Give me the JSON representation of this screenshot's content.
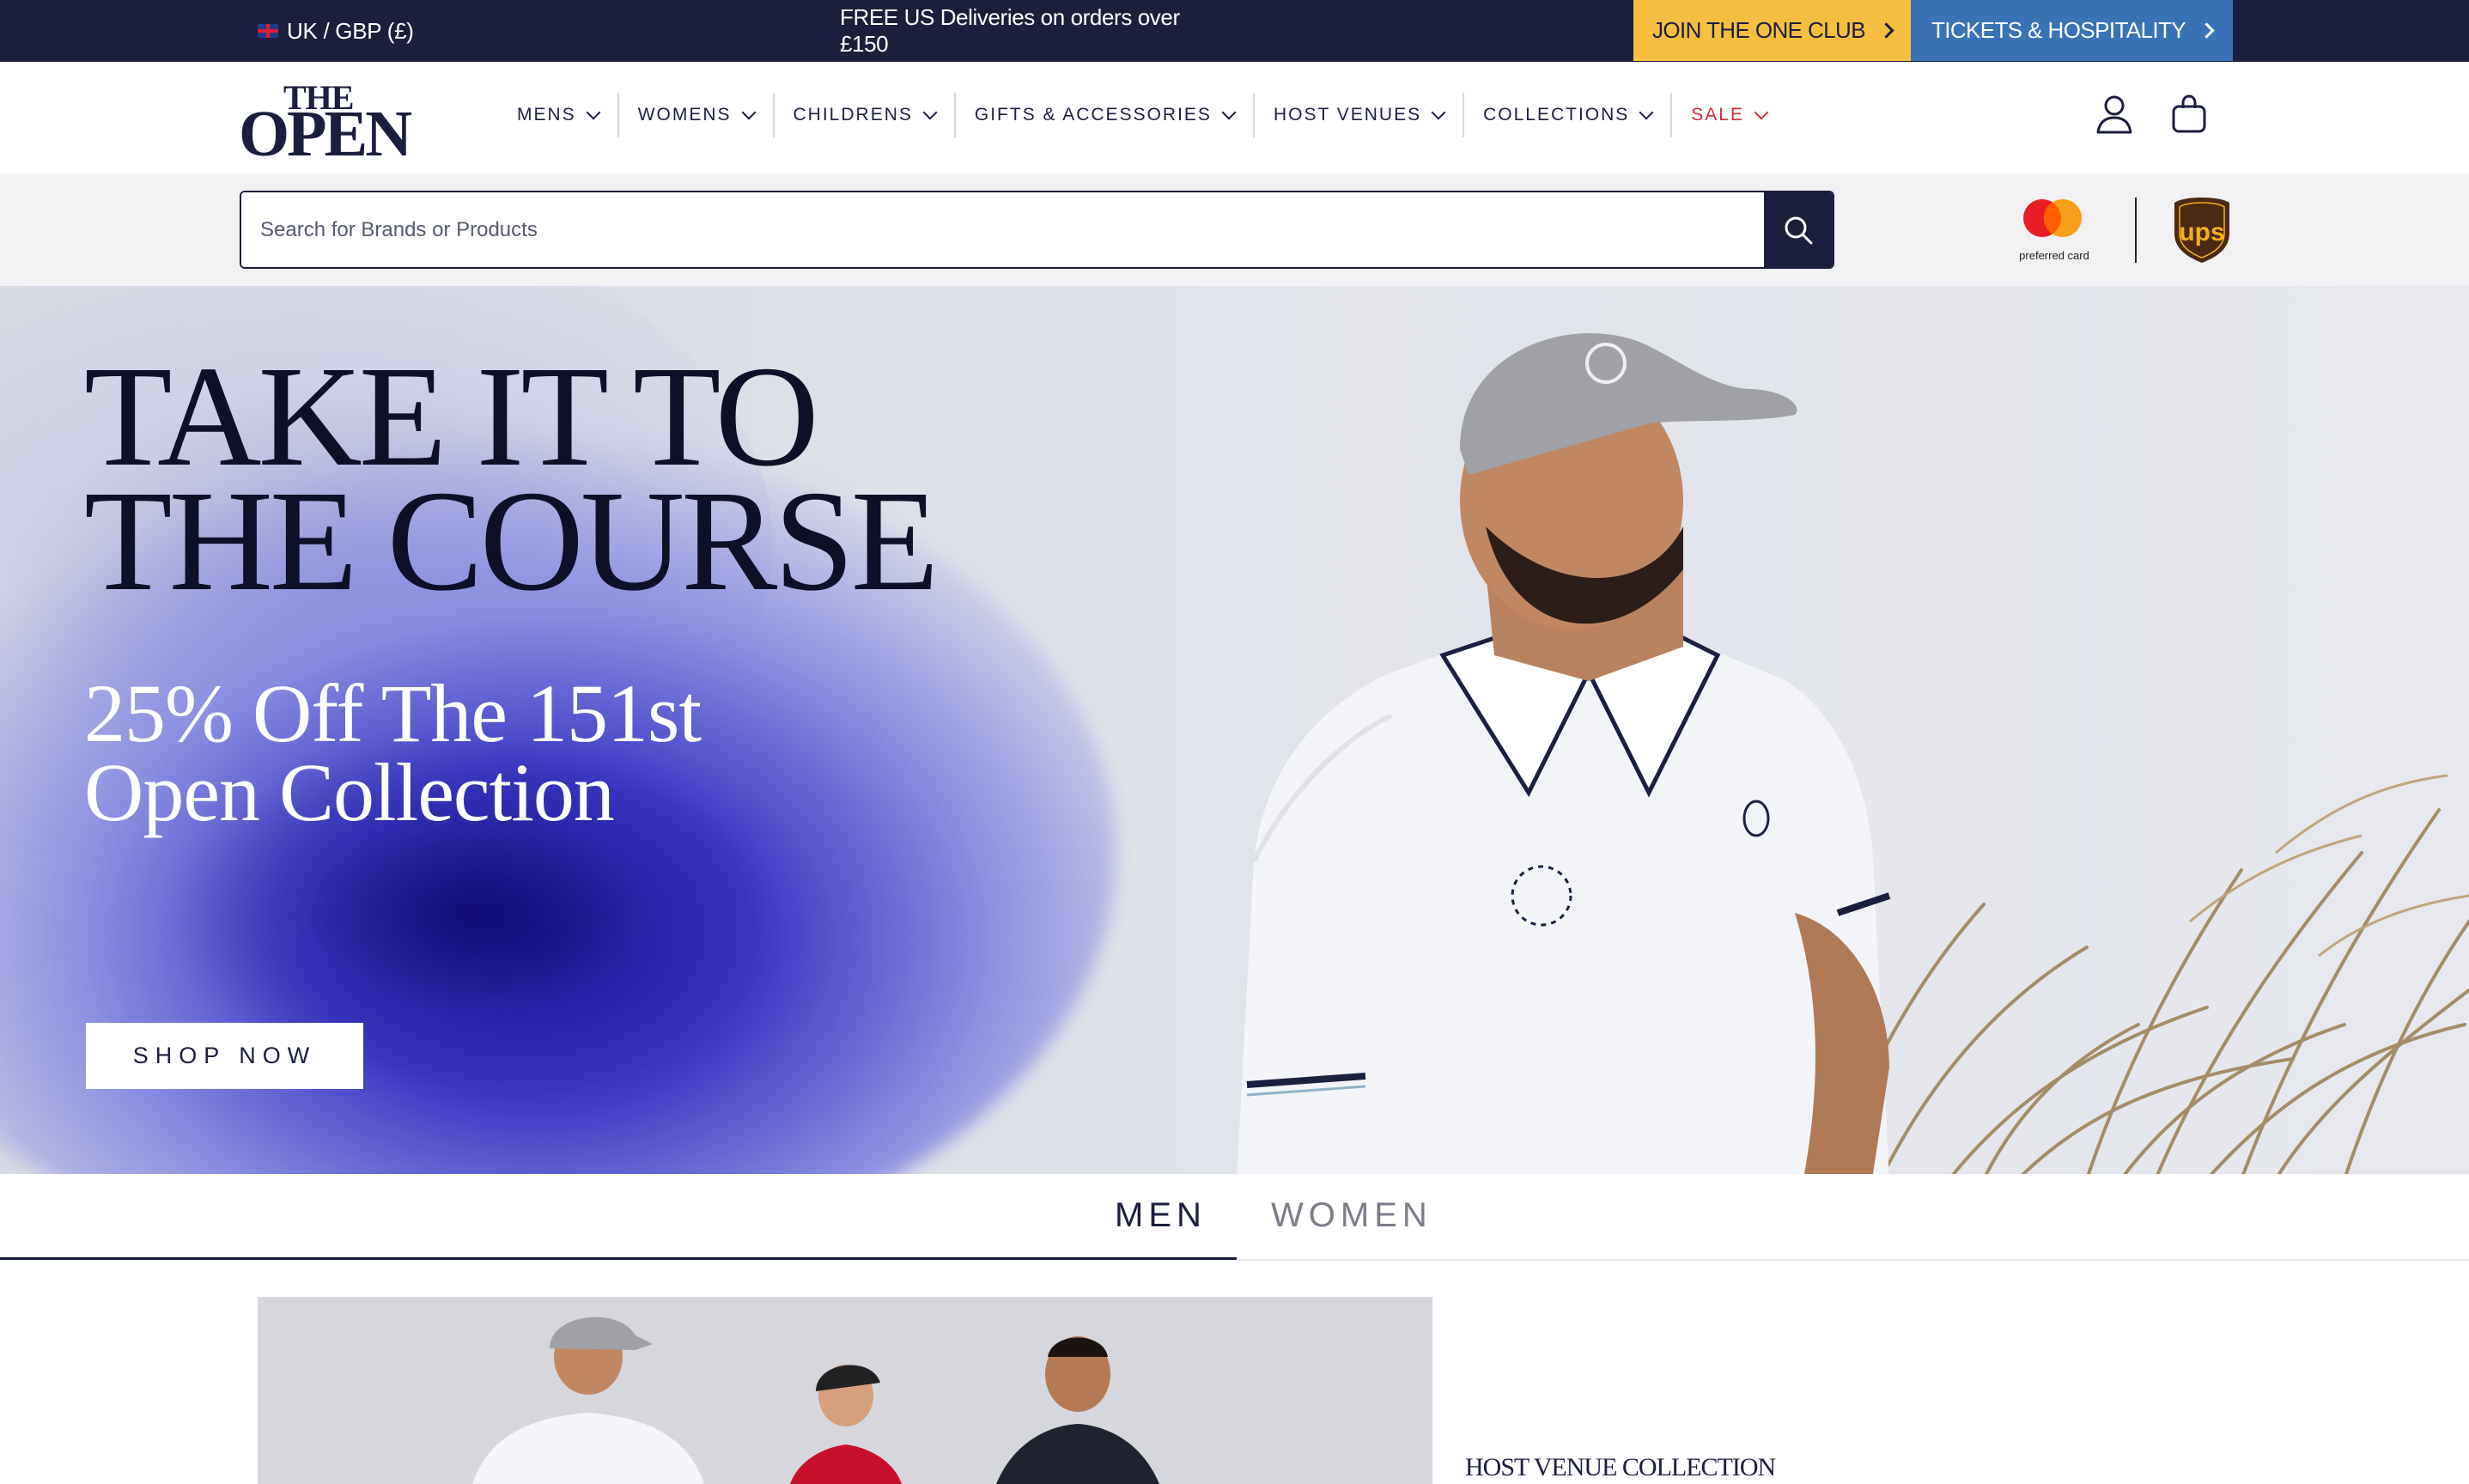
{
  "topbar": {
    "locale": "UK / GBP (£)",
    "promo": "FREE US Deliveries on orders over £150",
    "club_label": "JOIN THE ONE CLUB",
    "tickets_label": "TICKETS & HOSPITALITY"
  },
  "logo": {
    "line1": "THE",
    "line2": "OPEN"
  },
  "nav": {
    "items": [
      {
        "label": "MENS"
      },
      {
        "label": "WOMENS"
      },
      {
        "label": "CHILDRENS"
      },
      {
        "label": "GIFTS & ACCESSORIES"
      },
      {
        "label": "HOST VENUES"
      },
      {
        "label": "COLLECTIONS"
      },
      {
        "label": "SALE"
      }
    ]
  },
  "search": {
    "placeholder": "Search for Brands or Products",
    "value": ""
  },
  "partners": {
    "mastercard_label": "preferred card",
    "ups_label": "ups"
  },
  "hero": {
    "title_line1": "TAKE IT TO",
    "title_line2": "THE COURSE",
    "subtitle_line1": "25% Off The 151st",
    "subtitle_line2": "Open Collection",
    "cta": "SHOP NOW"
  },
  "tabs": [
    {
      "label": "MEN",
      "active": true
    },
    {
      "label": "WOMEN",
      "active": false
    }
  ],
  "collection": {
    "title": "HOST VENUE COLLECTION"
  },
  "colors": {
    "navy": "#1b1e3d",
    "gold": "#f4bf40",
    "blue": "#3a72b6",
    "sale_red": "#d22c3a"
  },
  "icons": [
    "uk-flag-icon",
    "chevron-right-icon",
    "chevron-down-icon",
    "account-icon",
    "bag-icon",
    "search-icon",
    "mastercard-logo",
    "ups-logo"
  ]
}
